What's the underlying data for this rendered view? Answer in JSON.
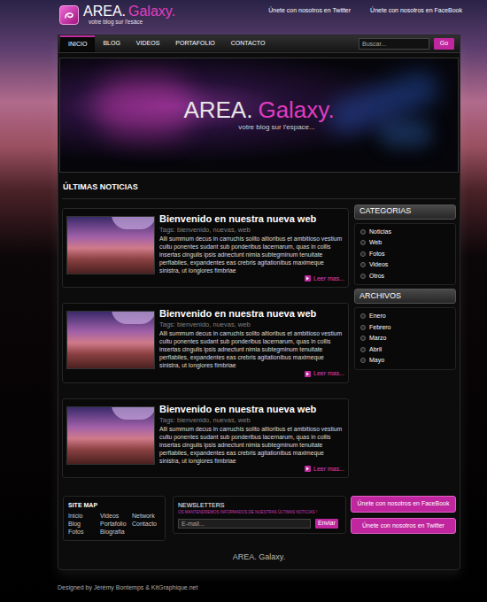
{
  "header": {
    "logo": {
      "title_a": "AREA.",
      "title_b": "Galaxy.",
      "tagline": "votre blog sur l'esàce"
    },
    "links": [
      "Únete con nosotros en Twitter",
      "Únete con nosotros en FaceBook"
    ]
  },
  "nav": {
    "items": [
      {
        "label": "INICIO",
        "selected": true
      },
      {
        "label": "BLOG",
        "selected": false
      },
      {
        "label": "VIDEOS",
        "selected": false
      },
      {
        "label": "PORTAFOLIO",
        "selected": false
      },
      {
        "label": "CONTACTO",
        "selected": false
      }
    ],
    "search": {
      "placeholder": "Buscar..."
    },
    "search_button": "Go"
  },
  "banner": {
    "title_a": "AREA.",
    "title_b": "Galaxy.",
    "tagline": "votre blog sur l'espace..."
  },
  "section_title": "ÚLTIMAS NOTICIAS",
  "posts": [
    {
      "title": "Bienvenido en nuestra nueva web",
      "tags": "Tags: bienvenido, nuevas, web",
      "body": "Alli summum decus in carruchis solito altioribus et ambitioso vestium cultu ponentes sudant sub ponderibus lacernarum, quas in collis insertas cingulis ipsis adnectunt nimia subtegminum tenuitate perflabiles, expandentes eas crebris agitationibus maximeque sinistra, ut longiores fimbriae",
      "more": "Leer mas..."
    },
    {
      "title": "Bienvenido en nuestra nueva web",
      "tags": "Tags: bienvenido, nuevas, web",
      "body": "Alli summum decus in carruchis solito altioribus et ambitioso vestium cultu ponentes sudant sub ponderibus lacernarum, quas in collis insertas cingulis ipsis adnectunt nimia subtegminum tenuitate perflabiles, expandentes eas crebris agitationibus maximeque sinistra, ut longiores fimbriae",
      "more": "Leer mas..."
    },
    {
      "title": "Bienvenido en nuestra nueva web",
      "tags": "Tags: bienvenido, nuevas, web",
      "body": "Alli summum decus in carruchis solito altioribus et ambitioso vestium cultu ponentes sudant sub ponderibus lacernarum, quas in collis insertas cingulis ipsis adnectunt nimia subtegminum tenuitate perflabiles, expandentes eas crebris agitationibus maximeque sinistra, ut longiores fimbriae",
      "more": "Leer mas..."
    }
  ],
  "sidebar": [
    {
      "title": "CATEGORIAS",
      "items": [
        "Noticias",
        "Web",
        "Fotos",
        "Videos",
        "Otros"
      ]
    },
    {
      "title": "ARCHIVOS",
      "items": [
        "Enero",
        "Febrero",
        "Marzo",
        "Abril",
        "Mayo"
      ]
    }
  ],
  "sitemap": {
    "title": "SITE MAP",
    "columns": [
      [
        "Inicio",
        "Blog",
        "Fotos"
      ],
      [
        "Videos",
        "Portafolio",
        "Biografia"
      ],
      [
        "Network",
        "Contacto"
      ]
    ]
  },
  "newsletter": {
    "title": "NEWSLETTERS",
    "subtitle": "OS MANTENDREMOS INFORMADOS DE NUESTRAS ÚLTIMAS NOTICIAS !",
    "placeholder": "E-mail...",
    "button": "Enviar"
  },
  "social_buttons": [
    "Únete con nosotros en FaceBook",
    "Únete con nosotros en Twitter"
  ],
  "footer_brand": "AREA. Galaxy.",
  "credit": "Designed by Jérémy Bontemps & KitGraphique.net"
}
